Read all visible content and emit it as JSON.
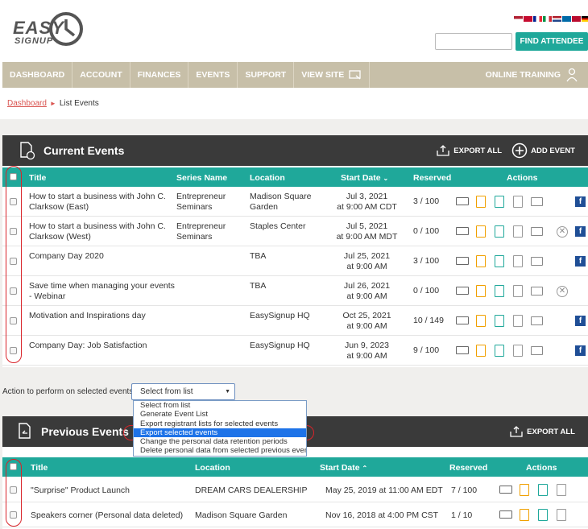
{
  "logo": {
    "line1": "EASY",
    "line2": "SIGNUP"
  },
  "colors": {
    "accent": "#1fa89a",
    "nav": "#c7bfa8",
    "dark": "#3a3a3a",
    "link": "#d9534f",
    "highlight": "#d9242a"
  },
  "header": {
    "find_button": "FIND ATTENDEE",
    "search_value": ""
  },
  "nav": {
    "items": [
      "DASHBOARD",
      "ACCOUNT",
      "FINANCES",
      "EVENTS",
      "SUPPORT",
      "VIEW SITE"
    ],
    "right": "ONLINE TRAINING"
  },
  "breadcrumb": {
    "home": "Dashboard",
    "current": "List Events"
  },
  "current": {
    "title": "Current Events",
    "export_all": "EXPORT ALL",
    "add_event": "ADD EVENT",
    "columns": [
      "Title",
      "Series Name",
      "Location",
      "Start Date",
      "Reserved",
      "Actions"
    ],
    "rows": [
      {
        "title1": "How to start a business with John C.",
        "title2": "Clarksow (East)",
        "series1": "Entrepreneur",
        "series2": "Seminars",
        "loc1": "Madison Square",
        "loc2": "Garden",
        "date1": "Jul 3, 2021",
        "date2": "at 9:00 AM CDT",
        "reserved": "3 / 100",
        "x": false,
        "fb": true
      },
      {
        "title1": "How to start a business with John C.",
        "title2": "Clarksow (West)",
        "series1": "Entrepreneur",
        "series2": "Seminars",
        "loc1": "Staples Center",
        "loc2": "",
        "date1": "Jul 5, 2021",
        "date2": "at 9:00 AM MDT",
        "reserved": "0 / 100",
        "x": true,
        "fb": true
      },
      {
        "title1": "Company Day 2020",
        "title2": "",
        "series1": "",
        "series2": "",
        "loc1": "TBA",
        "loc2": "",
        "date1": "Jul 25, 2021",
        "date2": "at 9:00 AM",
        "reserved": "3 / 100",
        "x": false,
        "fb": true
      },
      {
        "title1": "Save time when managing your events",
        "title2": "- Webinar",
        "series1": "",
        "series2": "",
        "loc1": "TBA",
        "loc2": "",
        "date1": "Jul 26, 2021",
        "date2": "at 9:00 AM",
        "reserved": "0 / 100",
        "x": true,
        "fb": false
      },
      {
        "title1": "Motivation and Inspirations day",
        "title2": "",
        "series1": "",
        "series2": "",
        "loc1": "EasySignup HQ",
        "loc2": "",
        "date1": "Oct 25, 2021",
        "date2": "at 9:00 AM",
        "reserved": "10 / 149",
        "x": false,
        "fb": true
      },
      {
        "title1": "Company Day: Job Satisfaction",
        "title2": "",
        "series1": "",
        "series2": "",
        "loc1": "EasySignup HQ",
        "loc2": "",
        "date1": "Jun 9, 2023",
        "date2": "at 9:00 AM",
        "reserved": "9 / 100",
        "x": false,
        "fb": true
      }
    ]
  },
  "action": {
    "label": "Action to perform on selected events:",
    "selected": "Select from list",
    "options": [
      "Select from list",
      "Generate Event List",
      "Export registrant lists for selected events",
      "Export selected events",
      "Change the personal data retention periods",
      "Delete personal data from selected previous events"
    ],
    "highlighted_index": 3
  },
  "previous": {
    "title": "Previous Events",
    "export_all": "EXPORT ALL",
    "columns": [
      "Title",
      "Location",
      "Start Date",
      "Reserved",
      "Actions"
    ],
    "rows": [
      {
        "title": "\"Surprise\" Product Launch",
        "loc": "DREAM CARS DEALERSHIP",
        "date": "May 25, 2019 at 11:00 AM EDT",
        "reserved": "7 / 100"
      },
      {
        "title": "Speakers corner (Personal data deleted)",
        "loc": "Madison Square Garden",
        "date": "Nov 16, 2018 at 4:00 PM CST",
        "reserved": "1 / 10"
      }
    ]
  }
}
